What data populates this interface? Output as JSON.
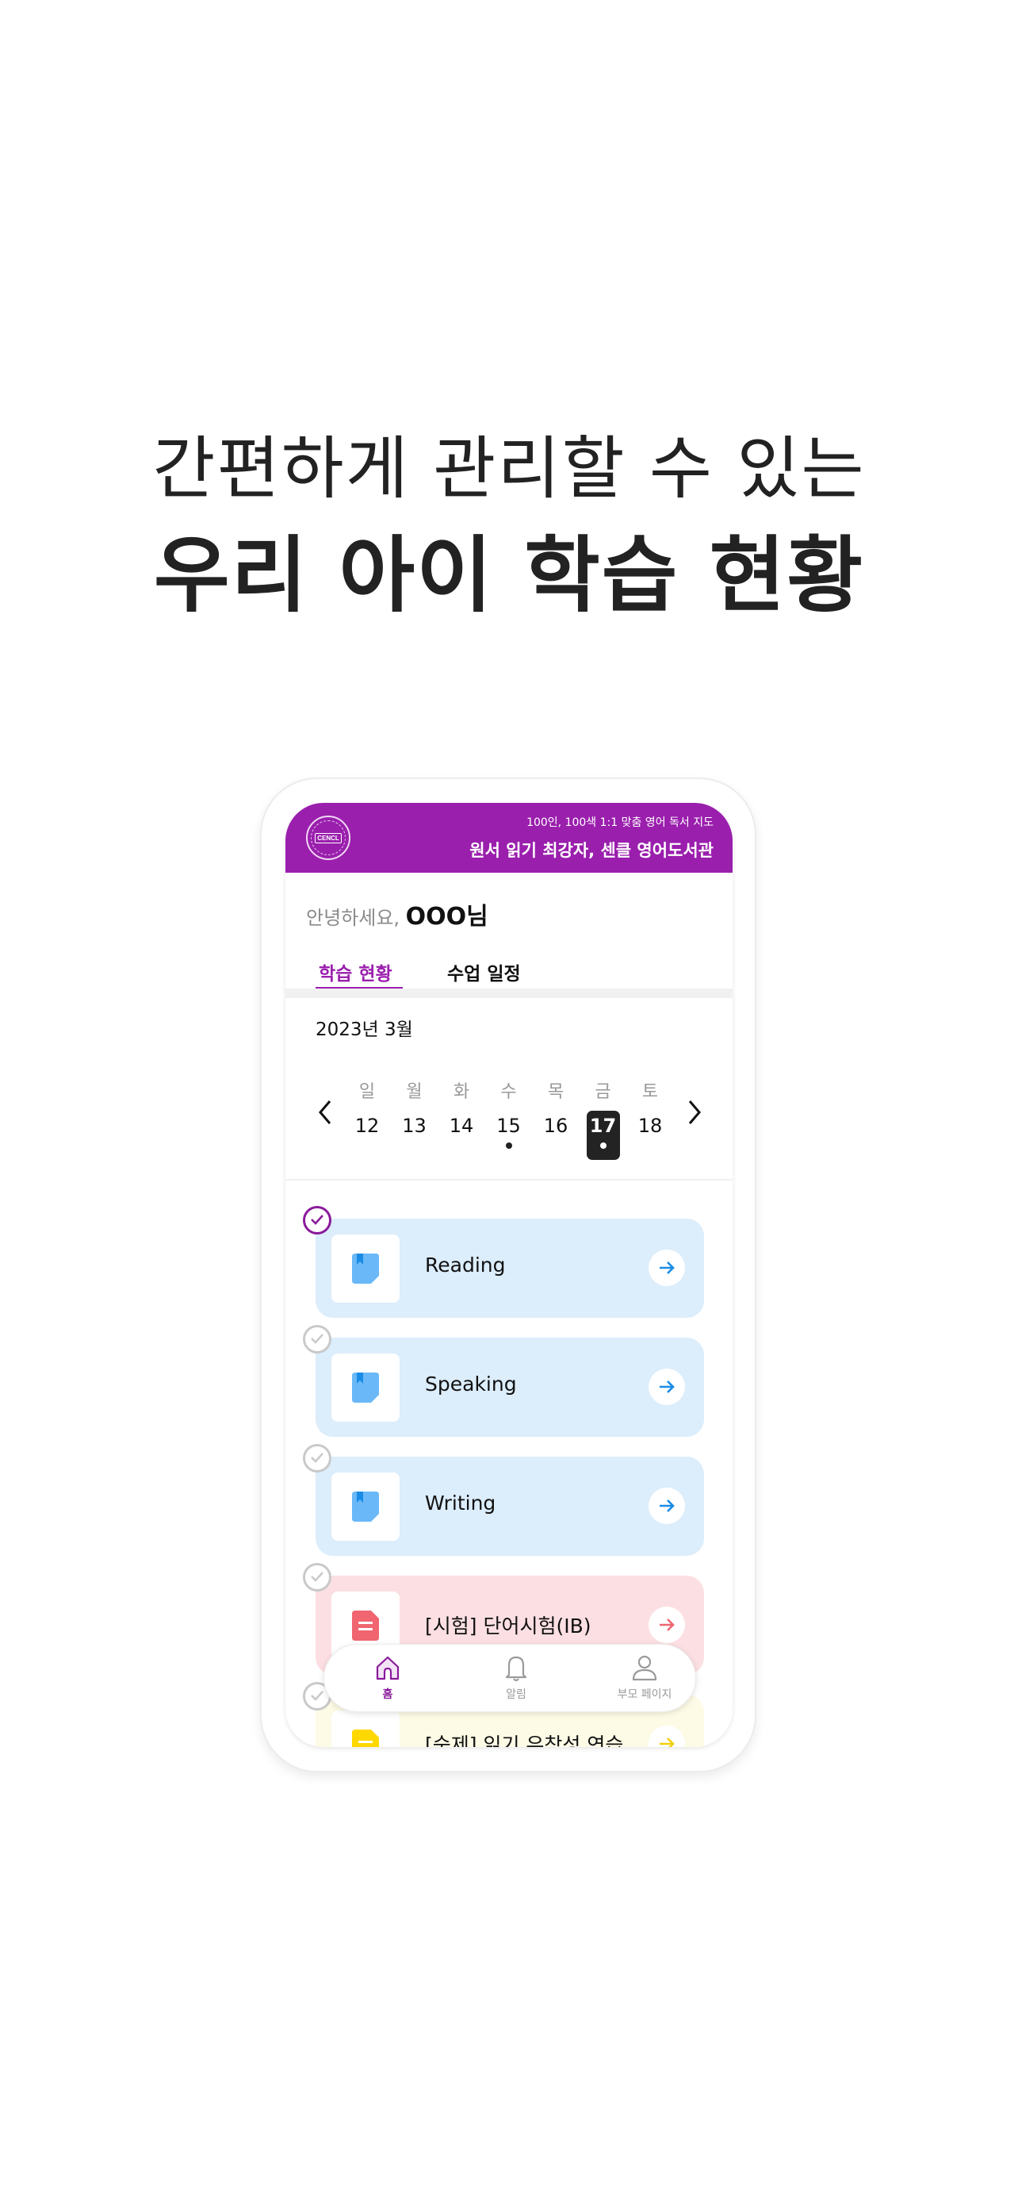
{
  "headline": {
    "line1": "간편하게 관리할 수 있는",
    "line2": "우리 아이 학습 현황"
  },
  "app": {
    "header": {
      "logo_text": "CENCL",
      "subtitle": "100인, 100색 1:1 맞춤 영어 독서 지도",
      "title": "원서 읽기 최강자, 센클 영어도서관"
    },
    "greeting": {
      "hello": "안녕하세요, ",
      "name": "OOO님"
    },
    "tabs": [
      {
        "label": "학습 현황",
        "active": true
      },
      {
        "label": "수업 일정",
        "active": false
      }
    ],
    "calendar": {
      "month_label": "2023년 3월",
      "prev_icon": "chevron-left-icon",
      "next_icon": "chevron-right-icon",
      "days": [
        {
          "weekday": "일",
          "date": "12",
          "has_event": false,
          "selected": false
        },
        {
          "weekday": "월",
          "date": "13",
          "has_event": false,
          "selected": false
        },
        {
          "weekday": "화",
          "date": "14",
          "has_event": false,
          "selected": false
        },
        {
          "weekday": "수",
          "date": "15",
          "has_event": true,
          "selected": false
        },
        {
          "weekday": "목",
          "date": "16",
          "has_event": false,
          "selected": false
        },
        {
          "weekday": "금",
          "date": "17",
          "has_event": true,
          "selected": true
        },
        {
          "weekday": "토",
          "date": "18",
          "has_event": false,
          "selected": false
        }
      ]
    },
    "tasks": [
      {
        "label": "Reading",
        "completed": true,
        "icon": "bookmark-document-icon",
        "bg": "#dcedfb",
        "accent": "#1a8ce6",
        "icon_color": "#6ab8f7"
      },
      {
        "label": "Speaking",
        "completed": false,
        "icon": "bookmark-document-icon",
        "bg": "#dcedfb",
        "accent": "#1a8ce6",
        "icon_color": "#6ab8f7"
      },
      {
        "label": "Writing",
        "completed": false,
        "icon": "bookmark-document-icon",
        "bg": "#dcedfb",
        "accent": "#1a8ce6",
        "icon_color": "#6ab8f7"
      },
      {
        "label": "[시험] 단어시험(IB)",
        "completed": false,
        "icon": "test-document-icon",
        "bg": "#fcdfe2",
        "accent": "#ef6672",
        "icon_color": "#f0656f"
      },
      {
        "label": "[숙제] 읽기 유창성 연습",
        "completed": false,
        "icon": "homework-document-icon",
        "bg": "#fdfbe6",
        "accent": "#f2cf10",
        "icon_color": "#ffd800"
      }
    ],
    "bottom_nav": [
      {
        "label": "홈",
        "icon": "home-icon",
        "active": true
      },
      {
        "label": "알림",
        "icon": "bell-icon",
        "active": false
      },
      {
        "label": "부모 페이지",
        "icon": "user-icon",
        "active": false
      }
    ],
    "colors": {
      "brand": "#9a1fad",
      "selected_day": "#232323"
    }
  }
}
